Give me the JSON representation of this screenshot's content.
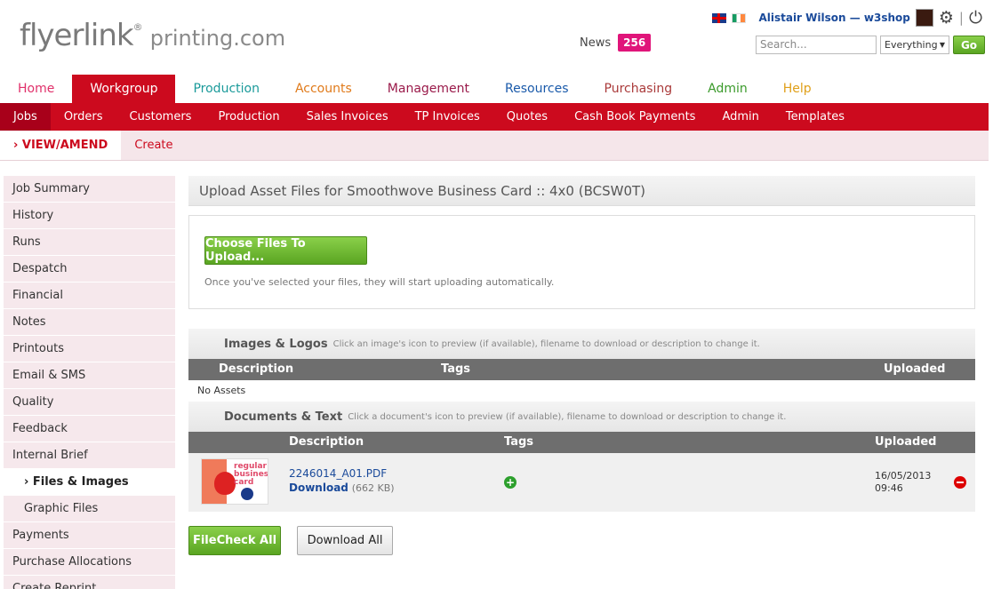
{
  "logo": {
    "brand": "flyerlink",
    "reg": "®",
    "suffix": "printing.com"
  },
  "news": {
    "label": "News",
    "count": "256"
  },
  "user": {
    "name": "Alistair Wilson — w3shop",
    "separator": "|"
  },
  "search": {
    "placeholder": "Search...",
    "scope": "Everything",
    "go_label": "Go"
  },
  "colors": {
    "brand_red": "#cc0a1e",
    "go_green": "#5aa522",
    "link_blue": "#1a4a9a",
    "news_pink": "#e0157a"
  },
  "main_nav": [
    {
      "label": "Home",
      "color": "#e0306a"
    },
    {
      "label": "Workgroup",
      "color": "#ffffff"
    },
    {
      "label": "Production",
      "color": "#1a9a9a"
    },
    {
      "label": "Accounts",
      "color": "#e07a1a"
    },
    {
      "label": "Management",
      "color": "#9a1a4a"
    },
    {
      "label": "Resources",
      "color": "#1a5aaa"
    },
    {
      "label": "Purchasing",
      "color": "#aa3a3a"
    },
    {
      "label": "Admin",
      "color": "#3a9a2a"
    },
    {
      "label": "Help",
      "color": "#e0a01a"
    }
  ],
  "sub_nav": [
    "Jobs",
    "Orders",
    "Customers",
    "Production",
    "Sales Invoices",
    "TP Invoices",
    "Quotes",
    "Cash Book Payments",
    "Admin",
    "Templates"
  ],
  "sub_sub_nav": {
    "view_amend": "› VIEW/AMEND",
    "create": "Create"
  },
  "sidebar": [
    "Job Summary",
    "History",
    "Runs",
    "Despatch",
    "Financial",
    "Notes",
    "Printouts",
    "Email & SMS",
    "Quality",
    "Feedback",
    "Internal Brief",
    "› Files & Images",
    "Graphic Files",
    "Payments",
    "Purchase Allocations",
    "Create Reprint"
  ],
  "upload": {
    "title": "Upload Asset Files for Smoothwove Business Card :: 4x0 (BCSW0T)",
    "choose_label": "Choose Files To Upload...",
    "hint": "Once you've selected your files, they will start uploading automatically."
  },
  "images_section": {
    "title": "Images & Logos",
    "desc": "Click an image's icon to preview (if available), filename to download or description to change it.",
    "headers": {
      "description": "Description",
      "tags": "Tags",
      "uploaded": "Uploaded"
    },
    "empty": "No Assets"
  },
  "docs_section": {
    "title": "Documents & Text",
    "desc": "Click a document's icon to preview (if available), filename to download or description to change it.",
    "headers": {
      "description": "Description",
      "tags": "Tags",
      "uploaded": "Uploaded"
    },
    "row": {
      "thumb_text": "regular business card",
      "filename": "2246014_A01.PDF",
      "download_label": "Download",
      "size": "(662 KB)",
      "date": "16/05/2013",
      "time": "09:46",
      "add_icon": "plus-circle-icon",
      "remove_icon": "minus-circle-icon"
    }
  },
  "actions": {
    "filecheck": "FileCheck All",
    "download_all": "Download All"
  }
}
